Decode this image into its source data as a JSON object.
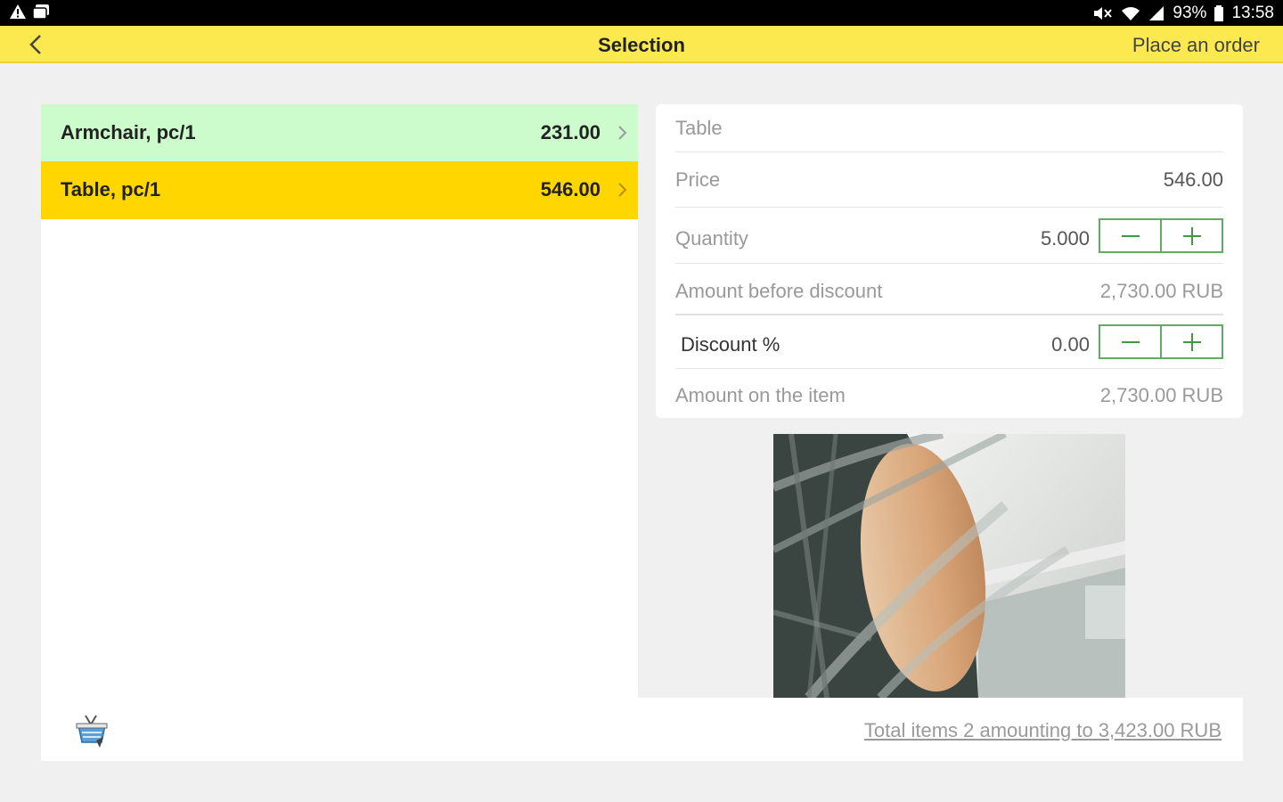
{
  "status_bar": {
    "battery": "93%",
    "time": "13:58"
  },
  "header": {
    "title": "Selection",
    "place_order_label": "Place an order"
  },
  "items": [
    {
      "name": "Armchair, pc/1",
      "price": "231.00",
      "color": "#ccfccc"
    },
    {
      "name": "Table, pc/1",
      "price": "546.00",
      "color": "#ffd600"
    }
  ],
  "details": {
    "item_name": "Table",
    "price_label": "Price",
    "price_value": "546.00",
    "quantity_label": "Quantity",
    "quantity_value": "5.000",
    "amount_before_label": "Amount before discount",
    "amount_before_value": "2,730.00 RUB",
    "discount_label": "Discount %",
    "discount_value": "0.00",
    "amount_item_label": "Amount on the item",
    "amount_item_value": "2,730.00 RUB"
  },
  "footer": {
    "total_text": "Total items 2 amounting to 3,423.00 RUB"
  },
  "colors": {
    "accent_yellow": "#fce94f",
    "selected_yellow": "#ffd600",
    "item_green": "#ccfccc",
    "stepper_green": "#3f9a3f"
  }
}
